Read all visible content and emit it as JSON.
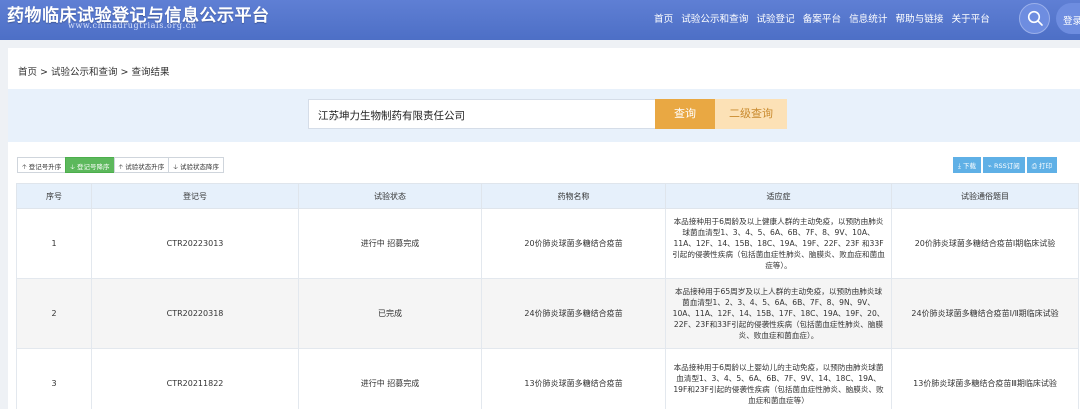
{
  "header": {
    "title": "药物临床试验登记与信息公示平台",
    "url": "www.chinadrugtrials.org.cn",
    "nav": [
      "首页",
      "试验公示和查询",
      "试验登记",
      "备案平台",
      "信息统计",
      "帮助与链接",
      "关于平台"
    ],
    "login": "登录"
  },
  "breadcrumb": "首页 > 试验公示和查询 > 查询结果",
  "search": {
    "value": "江苏坤力生物制药有限责任公司",
    "query_label": "查询",
    "secondary_label": "二级查询"
  },
  "sort_buttons": [
    "登记号升序",
    "登记号降序",
    "试验状态升序",
    "试验状态降序"
  ],
  "tool_buttons": [
    "下载",
    "RSS订阅",
    "打印"
  ],
  "table": {
    "headers": [
      "序号",
      "登记号",
      "试验状态",
      "药物名称",
      "适应症",
      "试验通俗题目"
    ],
    "rows": [
      {
        "no": "1",
        "reg": "CTR20223013",
        "status": "进行中 招募完成",
        "drug": "20价肺炎球菌多糖结合疫苗",
        "indication": "本品接种用于6周龄及以上健康人群的主动免疫，以预防由肺炎球菌血清型1、3、4、5、6A、6B、7F、8、9V、10A、11A、12F、14、15B、18C、19A、19F、22F、23F 和33F引起的侵袭性疾病（包括菌血症性肺炎、脑膜炎、败血症和菌血症等）。",
        "title": "20价肺炎球菌多糖结合疫苗Ⅰ期临床试验"
      },
      {
        "no": "2",
        "reg": "CTR20220318",
        "status": "已完成",
        "drug": "24价肺炎球菌多糖结合疫苗",
        "indication": "本品接种用于65周岁及以上人群的主动免疫，以预防由肺炎球菌血清型1、2、3、4、5、6A、6B、7F、8、9N、9V、10A、11A、12F、14、15B、17F、18C、19A、19F、20、22F、23F和33F引起的侵袭性疾病（包括菌血症性肺炎、脑膜炎、败血症和菌血症）。",
        "title": "24价肺炎球菌多糖结合疫苗Ⅰ/Ⅱ期临床试验"
      },
      {
        "no": "3",
        "reg": "CTR20211822",
        "status": "进行中 招募完成",
        "drug": "13价肺炎球菌多糖结合疫苗",
        "indication": "本品接种用于6周龄以上婴幼儿的主动免疫，以预防由肺炎球菌血清型1、3、4、5、6A、6B、7F、9V、14、18C、19A、19F和23F引起的侵袭性疾病（包括菌血症性肺炎、脑膜炎、败血症和菌血症等）",
        "title": "13价肺炎球菌多糖结合疫苗Ⅲ期临床试验"
      }
    ]
  },
  "colors": {
    "header": "#5b7bd1",
    "query": "#e9a843",
    "secondary": "#fce1b6",
    "sort_active": "#5cb85c",
    "tool": "#5fb0e6"
  }
}
